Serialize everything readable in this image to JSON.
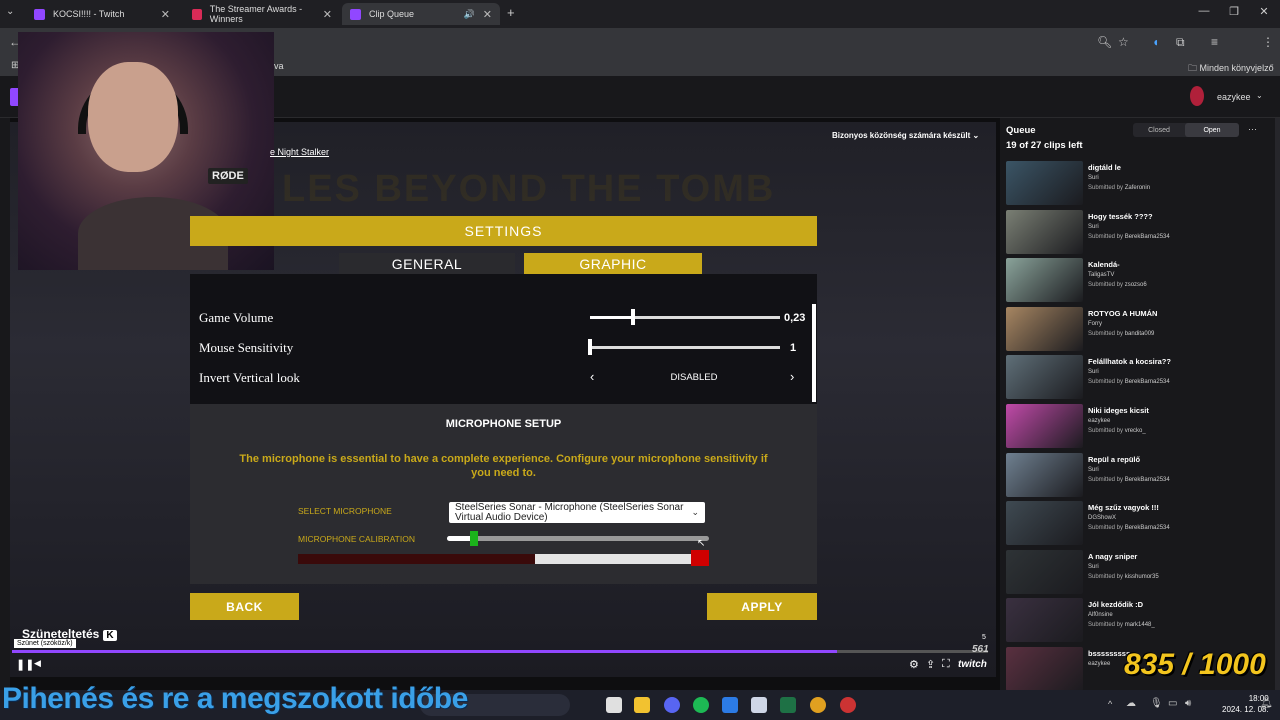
{
  "browser": {
    "tabs": [
      {
        "title": "KOCSI!!!! - Twitch",
        "color": "#9147ff"
      },
      {
        "title": "The Streamer Awards - Winners",
        "color": "#d92b57"
      },
      {
        "title": "Clip Queue",
        "color": "#9147ff",
        "active": true
      }
    ],
    "bookmarks_folder": "Minden könyvjelző",
    "bookmark_fragment": "va"
  },
  "twitch": {
    "username": "eazykee"
  },
  "video": {
    "title_link": "e Night Stalker",
    "audience_label": "Bizonyos közönség számára készült",
    "game_banner": "LES BEYOND THE TOMB",
    "webcam_mic_brand": "RØDE"
  },
  "settings": {
    "header": "SETTINGS",
    "tabs": [
      "GENERAL",
      "GRAPHIC"
    ],
    "rows": [
      {
        "label": "Game Volume",
        "value": "0,23",
        "level": 0.23
      },
      {
        "label": "Mouse Sensitivity",
        "value": "1",
        "level": 0.0
      },
      {
        "label": "Invert Vertical look",
        "value": "DISABLED"
      }
    ],
    "mic": {
      "title": "MICROPHONE SETUP",
      "description": "The microphone is essential to have a complete experience. Configure your microphone sensitivity if you need to.",
      "select_label": "SELECT MICROPHONE",
      "select_value": "SteelSeries Sonar - Microphone (SteelSeries Sonar Virtual Audio Device)",
      "calib_label": "MICROPHONE CALIBRATION",
      "calibration_level": 0.1
    },
    "back": "BACK",
    "apply": "APPLY"
  },
  "player": {
    "pause_label": "Szüneteltetés",
    "pause_key": "K",
    "tooltip": "Szünet (szóköz/k)",
    "progress": 0.845,
    "twitch_logo": "twitch",
    "viewer_small": "5",
    "viewer_count": "561"
  },
  "queue": {
    "title": "Queue",
    "clips_left": "19 of 27 clips left",
    "closed": "Closed",
    "open": "Open",
    "items": [
      {
        "title": "digtáld le",
        "author": "Suri",
        "submitted_prefix": "Submitted by",
        "submitter": "Zaferonin",
        "thumb": "#3b5566"
      },
      {
        "title": "Hogy tessék ????",
        "author": "Suri",
        "submitted_prefix": "Submitted by",
        "submitter": "BerekBarna2534",
        "thumb": "#7a7f74"
      },
      {
        "title": "Kalendá-",
        "author": "TaligasTV",
        "submitted_prefix": "Submitted by",
        "submitter": "zsozso6",
        "thumb": "#8aa39a"
      },
      {
        "title": "ROTYOG A HUMÁN",
        "author": "Forry",
        "submitted_prefix": "Submitted by",
        "submitter": "bandita009",
        "thumb": "#a78662"
      },
      {
        "title": "Felállhatok a kocsira??",
        "author": "Suri",
        "submitted_prefix": "Submitted by",
        "submitter": "BerekBarna2534",
        "thumb": "#5f6f78"
      },
      {
        "title": "Niki ideges kicsit",
        "author": "eazykee",
        "submitted_prefix": "Submitted by",
        "submitter": "vrecko_",
        "thumb": "#c04aa8"
      },
      {
        "title": "Repül a repülő",
        "author": "Suri",
        "submitted_prefix": "Submitted by",
        "submitter": "BerekBarna2534",
        "thumb": "#6f8090"
      },
      {
        "title": "Még szűz vagyok !!!",
        "author": "DGShowX",
        "submitted_prefix": "Submitted by",
        "submitter": "BerekBarna2534",
        "thumb": "#3f4a52"
      },
      {
        "title": "A nagy sniper",
        "author": "Suri",
        "submitted_prefix": "Submitted by",
        "submitter": "kisshumor35",
        "thumb": "#2e3336"
      },
      {
        "title": "Jól kezdődik :D",
        "author": "Alf0nsine",
        "submitted_prefix": "Submitted by",
        "submitter": "mark1448_",
        "thumb": "#3a3040"
      },
      {
        "title": "bsssssssss",
        "author": "eazykee",
        "submitted_prefix": "",
        "submitter": "",
        "thumb": "#5a3040"
      }
    ]
  },
  "overlay": {
    "counter": "835 / 1000",
    "subtitle": "Pihenés és re a megszokott időbe"
  },
  "taskbar": {
    "time": "18:00",
    "date": "2024. 12. 08."
  }
}
